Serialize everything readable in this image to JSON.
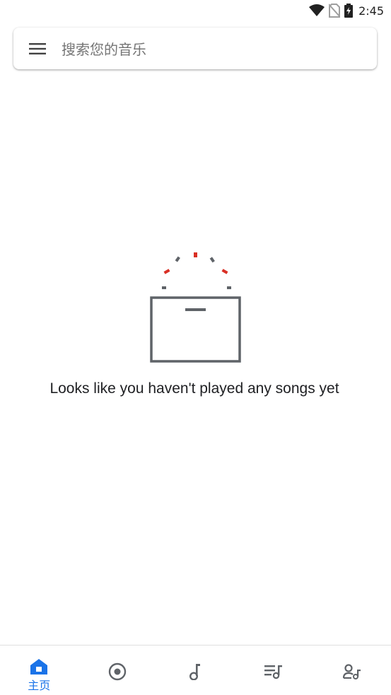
{
  "status_bar": {
    "time": "2:45",
    "icons": [
      "wifi-icon",
      "no-sim-icon",
      "battery-charging-icon"
    ]
  },
  "search": {
    "placeholder": "搜索您的音乐",
    "menu_icon": "hamburger-menu-icon"
  },
  "empty_state": {
    "message": "Looks like you haven't played any songs yet",
    "illustration": "speaker-box-icon"
  },
  "bottom_nav": {
    "items": [
      {
        "icon": "home-icon",
        "label": "主页",
        "active": true
      },
      {
        "icon": "album-icon",
        "label": "",
        "active": false
      },
      {
        "icon": "music-note-icon",
        "label": "",
        "active": false
      },
      {
        "icon": "playlist-icon",
        "label": "",
        "active": false
      },
      {
        "icon": "artist-icon",
        "label": "",
        "active": false
      }
    ]
  },
  "colors": {
    "accent": "#1a73e8",
    "icon_gray": "#5f6368",
    "illustration_red": "#d93025"
  }
}
